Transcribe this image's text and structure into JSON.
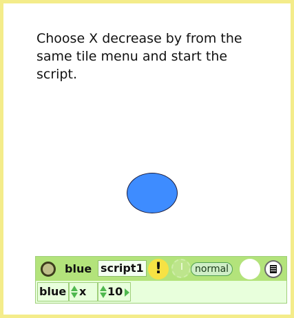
{
  "instruction": {
    "text": "Choose X decrease by from the same tile menu and start the script."
  },
  "canvas": {
    "shape_color": "#3e8cff"
  },
  "scriptor": {
    "player_name": "blue",
    "script_name": "script1",
    "alert_symbol": "!",
    "status": "normal",
    "icons": [
      "menu-circle-icon",
      "alert-icon",
      "clock-icon",
      "blank-circle-icon",
      "document-icon"
    ]
  },
  "tiles": {
    "player": "blue",
    "slot": "x",
    "value": "10"
  }
}
